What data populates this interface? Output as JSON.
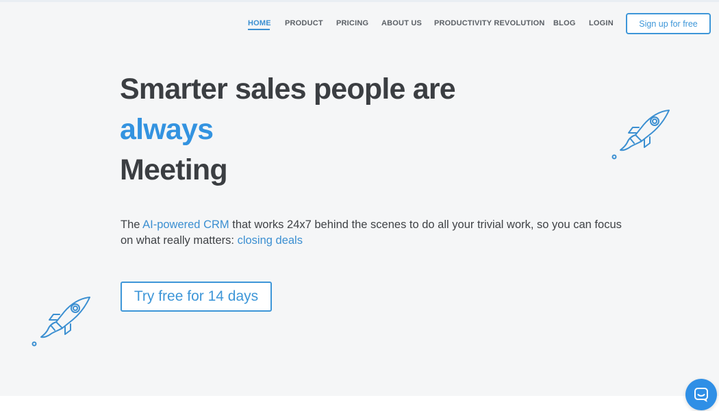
{
  "nav": {
    "items": [
      {
        "label": "HOME",
        "active": true
      },
      {
        "label": "PRODUCT",
        "active": false
      },
      {
        "label": "PRICING",
        "active": false
      },
      {
        "label": "ABOUT US",
        "active": false
      },
      {
        "label": "PRODUCTIVITY REVOLUTION",
        "active": false
      },
      {
        "label": "BLOG",
        "active": false
      },
      {
        "label": "LOGIN",
        "active": false
      }
    ],
    "signup_label": "Sign up for free"
  },
  "hero": {
    "line1": "Smarter sales people are",
    "line2": "always",
    "line3": "Meeting",
    "sub_prefix": "The ",
    "sub_link1": "AI-powered CRM",
    "sub_middle": " that works 24x7 behind the scenes to do all your trivial work, so you can focus on what really matters: ",
    "sub_link2": "closing deals",
    "cta_label": "Try free for 14 days"
  },
  "icons": {
    "rocket_top": "rocket-icon",
    "rocket_bottom": "rocket-icon",
    "chat": "chat-icon"
  },
  "colors": {
    "accent": "#3b8fd1",
    "headline": "#3b3e42",
    "background": "#f5f6f7",
    "chat": "#2f8fe6"
  }
}
